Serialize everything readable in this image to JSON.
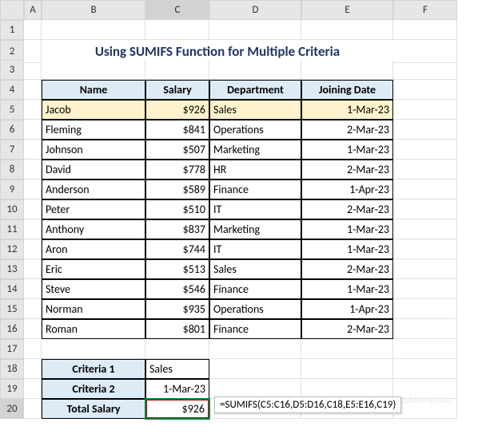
{
  "columns": [
    "A",
    "B",
    "C",
    "D",
    "E",
    "F"
  ],
  "rows": [
    "1",
    "2",
    "3",
    "4",
    "5",
    "6",
    "7",
    "8",
    "9",
    "10",
    "11",
    "12",
    "13",
    "14",
    "15",
    "16",
    "17",
    "18",
    "19",
    "20"
  ],
  "selectedCol": "C",
  "selectedRow": "20",
  "title": "Using SUMIFS Function for Multiple Criteria",
  "headers": {
    "name": "Name",
    "salary": "Salary",
    "dept": "Department",
    "date": "Joining Date"
  },
  "data": [
    {
      "name": "Jacob",
      "salary": "$926",
      "dept": "Sales",
      "date": "1-Mar-23",
      "hl": true
    },
    {
      "name": "Fleming",
      "salary": "$841",
      "dept": "Operations",
      "date": "2-Mar-23"
    },
    {
      "name": "Johnson",
      "salary": "$507",
      "dept": "Marketing",
      "date": "1-Mar-23"
    },
    {
      "name": "David",
      "salary": "$778",
      "dept": "HR",
      "date": "2-Mar-23"
    },
    {
      "name": "Anderson",
      "salary": "$589",
      "dept": "Finance",
      "date": "1-Apr-23"
    },
    {
      "name": "Peter",
      "salary": "$510",
      "dept": "IT",
      "date": "2-Mar-23"
    },
    {
      "name": "Anthony",
      "salary": "$837",
      "dept": "Marketing",
      "date": "1-Mar-23"
    },
    {
      "name": "Aron",
      "salary": "$744",
      "dept": "IT",
      "date": "1-Mar-23"
    },
    {
      "name": "Eric",
      "salary": "$513",
      "dept": "Sales",
      "date": "2-Mar-23"
    },
    {
      "name": "Steve",
      "salary": "$546",
      "dept": "Finance",
      "date": "1-Mar-23"
    },
    {
      "name": "Norman",
      "salary": "$935",
      "dept": "Operations",
      "date": "1-Apr-23"
    },
    {
      "name": "Roman",
      "salary": "$801",
      "dept": "Finance",
      "date": "2-Mar-23"
    }
  ],
  "criteria": {
    "label1": "Criteria 1",
    "val1": "Sales",
    "label2": "Criteria 2",
    "val2": "1-Mar-23",
    "label3": "Total Salary",
    "result": "$926"
  },
  "formula": "=SUMIFS(C5:C16,D5:D16,C18,E5:E16,C19)",
  "watermark": "xceldemy.com"
}
